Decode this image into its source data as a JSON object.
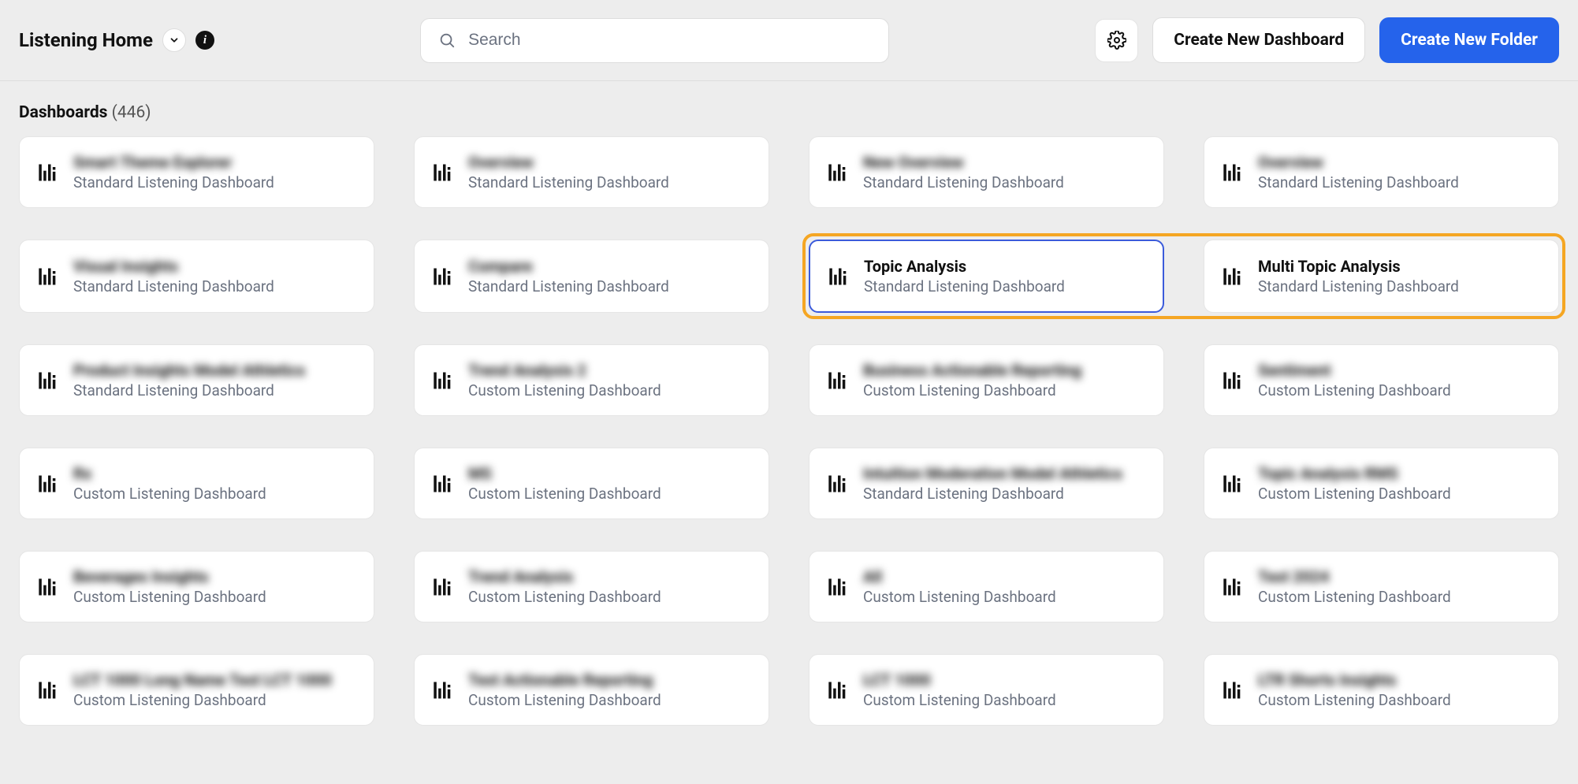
{
  "header": {
    "title": "Listening Home",
    "search_placeholder": "Search",
    "create_dashboard_label": "Create New Dashboard",
    "create_folder_label": "Create New Folder"
  },
  "section": {
    "title": "Dashboards",
    "count": "(446)"
  },
  "cards": [
    {
      "title": "Smart Theme Explorer",
      "sub": "Standard Listening Dashboard",
      "blur": true,
      "selected": false
    },
    {
      "title": "Overview",
      "sub": "Standard Listening Dashboard",
      "blur": true,
      "selected": false
    },
    {
      "title": "New Overview",
      "sub": "Standard Listening Dashboard",
      "blur": true,
      "selected": false
    },
    {
      "title": "Overview",
      "sub": "Standard Listening Dashboard",
      "blur": true,
      "selected": false
    },
    {
      "title": "Visual Insights",
      "sub": "Standard Listening Dashboard",
      "blur": true,
      "selected": false
    },
    {
      "title": "Compare",
      "sub": "Standard Listening Dashboard",
      "blur": true,
      "selected": false
    },
    {
      "title": "Topic Analysis",
      "sub": "Standard Listening Dashboard",
      "blur": false,
      "selected": true
    },
    {
      "title": "Multi Topic Analysis",
      "sub": "Standard Listening Dashboard",
      "blur": false,
      "selected": false
    },
    {
      "title": "Product Insights Model Athletics",
      "sub": "Standard Listening Dashboard",
      "blur": true,
      "selected": false
    },
    {
      "title": "Trend Analysis 2",
      "sub": "Custom Listening Dashboard",
      "blur": true,
      "selected": false
    },
    {
      "title": "Business Actionable Reporting",
      "sub": "Custom Listening Dashboard",
      "blur": true,
      "selected": false
    },
    {
      "title": "Sentiment",
      "sub": "Custom Listening Dashboard",
      "blur": true,
      "selected": false
    },
    {
      "title": "Rx",
      "sub": "Custom Listening Dashboard",
      "blur": true,
      "selected": false
    },
    {
      "title": "MS",
      "sub": "Custom Listening Dashboard",
      "blur": true,
      "selected": false
    },
    {
      "title": "Intuition Moderation Model Athletics",
      "sub": "Standard Listening Dashboard",
      "blur": true,
      "selected": false
    },
    {
      "title": "Topic Analysis RMS",
      "sub": "Custom Listening Dashboard",
      "blur": true,
      "selected": false
    },
    {
      "title": "Beverages Insights",
      "sub": "Custom Listening Dashboard",
      "blur": true,
      "selected": false
    },
    {
      "title": "Trend Analysis",
      "sub": "Custom Listening Dashboard",
      "blur": true,
      "selected": false
    },
    {
      "title": "All",
      "sub": "Custom Listening Dashboard",
      "blur": true,
      "selected": false
    },
    {
      "title": "Test 2024",
      "sub": "Custom Listening Dashboard",
      "blur": true,
      "selected": false
    },
    {
      "title": "LCT 1000 Long Name Test LCT 1000",
      "sub": "Custom Listening Dashboard",
      "blur": true,
      "selected": false
    },
    {
      "title": "Test Actionable Reporting",
      "sub": "Custom Listening Dashboard",
      "blur": true,
      "selected": false
    },
    {
      "title": "LCT 1000",
      "sub": "Custom Listening Dashboard",
      "blur": true,
      "selected": false
    },
    {
      "title": "LTR Shorts Insights",
      "sub": "Custom Listening Dashboard",
      "blur": true,
      "selected": false
    }
  ]
}
